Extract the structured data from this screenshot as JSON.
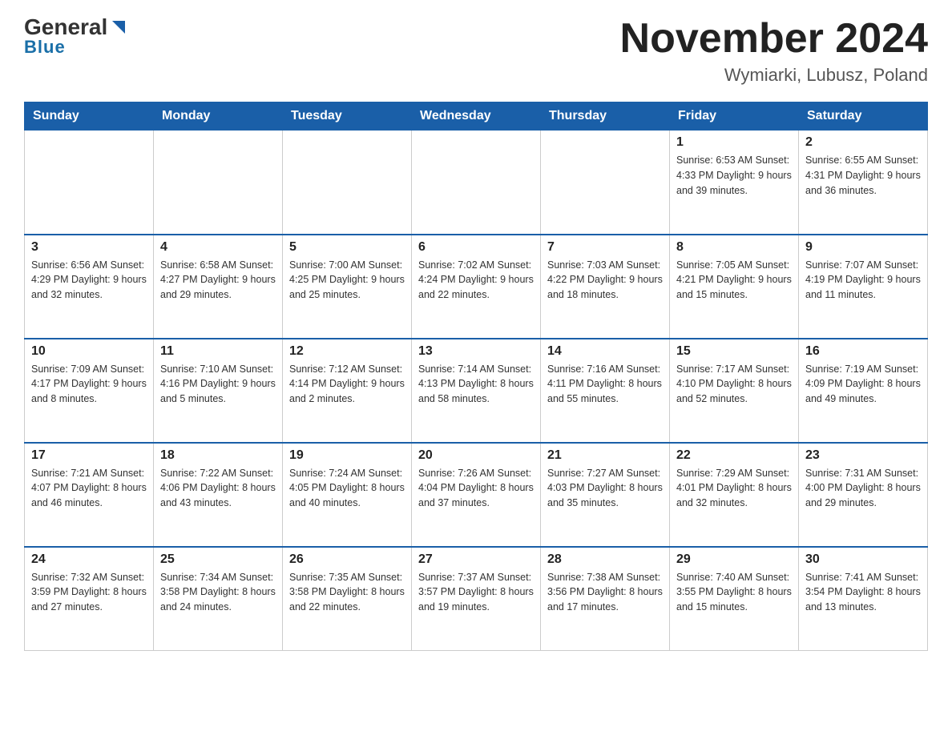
{
  "header": {
    "logo": {
      "general": "General",
      "blue": "Blue"
    },
    "title": "November 2024",
    "subtitle": "Wymiarki, Lubusz, Poland"
  },
  "calendar": {
    "days_of_week": [
      "Sunday",
      "Monday",
      "Tuesday",
      "Wednesday",
      "Thursday",
      "Friday",
      "Saturday"
    ],
    "weeks": [
      [
        {
          "day": "",
          "info": ""
        },
        {
          "day": "",
          "info": ""
        },
        {
          "day": "",
          "info": ""
        },
        {
          "day": "",
          "info": ""
        },
        {
          "day": "",
          "info": ""
        },
        {
          "day": "1",
          "info": "Sunrise: 6:53 AM\nSunset: 4:33 PM\nDaylight: 9 hours\nand 39 minutes."
        },
        {
          "day": "2",
          "info": "Sunrise: 6:55 AM\nSunset: 4:31 PM\nDaylight: 9 hours\nand 36 minutes."
        }
      ],
      [
        {
          "day": "3",
          "info": "Sunrise: 6:56 AM\nSunset: 4:29 PM\nDaylight: 9 hours\nand 32 minutes."
        },
        {
          "day": "4",
          "info": "Sunrise: 6:58 AM\nSunset: 4:27 PM\nDaylight: 9 hours\nand 29 minutes."
        },
        {
          "day": "5",
          "info": "Sunrise: 7:00 AM\nSunset: 4:25 PM\nDaylight: 9 hours\nand 25 minutes."
        },
        {
          "day": "6",
          "info": "Sunrise: 7:02 AM\nSunset: 4:24 PM\nDaylight: 9 hours\nand 22 minutes."
        },
        {
          "day": "7",
          "info": "Sunrise: 7:03 AM\nSunset: 4:22 PM\nDaylight: 9 hours\nand 18 minutes."
        },
        {
          "day": "8",
          "info": "Sunrise: 7:05 AM\nSunset: 4:21 PM\nDaylight: 9 hours\nand 15 minutes."
        },
        {
          "day": "9",
          "info": "Sunrise: 7:07 AM\nSunset: 4:19 PM\nDaylight: 9 hours\nand 11 minutes."
        }
      ],
      [
        {
          "day": "10",
          "info": "Sunrise: 7:09 AM\nSunset: 4:17 PM\nDaylight: 9 hours\nand 8 minutes."
        },
        {
          "day": "11",
          "info": "Sunrise: 7:10 AM\nSunset: 4:16 PM\nDaylight: 9 hours\nand 5 minutes."
        },
        {
          "day": "12",
          "info": "Sunrise: 7:12 AM\nSunset: 4:14 PM\nDaylight: 9 hours\nand 2 minutes."
        },
        {
          "day": "13",
          "info": "Sunrise: 7:14 AM\nSunset: 4:13 PM\nDaylight: 8 hours\nand 58 minutes."
        },
        {
          "day": "14",
          "info": "Sunrise: 7:16 AM\nSunset: 4:11 PM\nDaylight: 8 hours\nand 55 minutes."
        },
        {
          "day": "15",
          "info": "Sunrise: 7:17 AM\nSunset: 4:10 PM\nDaylight: 8 hours\nand 52 minutes."
        },
        {
          "day": "16",
          "info": "Sunrise: 7:19 AM\nSunset: 4:09 PM\nDaylight: 8 hours\nand 49 minutes."
        }
      ],
      [
        {
          "day": "17",
          "info": "Sunrise: 7:21 AM\nSunset: 4:07 PM\nDaylight: 8 hours\nand 46 minutes."
        },
        {
          "day": "18",
          "info": "Sunrise: 7:22 AM\nSunset: 4:06 PM\nDaylight: 8 hours\nand 43 minutes."
        },
        {
          "day": "19",
          "info": "Sunrise: 7:24 AM\nSunset: 4:05 PM\nDaylight: 8 hours\nand 40 minutes."
        },
        {
          "day": "20",
          "info": "Sunrise: 7:26 AM\nSunset: 4:04 PM\nDaylight: 8 hours\nand 37 minutes."
        },
        {
          "day": "21",
          "info": "Sunrise: 7:27 AM\nSunset: 4:03 PM\nDaylight: 8 hours\nand 35 minutes."
        },
        {
          "day": "22",
          "info": "Sunrise: 7:29 AM\nSunset: 4:01 PM\nDaylight: 8 hours\nand 32 minutes."
        },
        {
          "day": "23",
          "info": "Sunrise: 7:31 AM\nSunset: 4:00 PM\nDaylight: 8 hours\nand 29 minutes."
        }
      ],
      [
        {
          "day": "24",
          "info": "Sunrise: 7:32 AM\nSunset: 3:59 PM\nDaylight: 8 hours\nand 27 minutes."
        },
        {
          "day": "25",
          "info": "Sunrise: 7:34 AM\nSunset: 3:58 PM\nDaylight: 8 hours\nand 24 minutes."
        },
        {
          "day": "26",
          "info": "Sunrise: 7:35 AM\nSunset: 3:58 PM\nDaylight: 8 hours\nand 22 minutes."
        },
        {
          "day": "27",
          "info": "Sunrise: 7:37 AM\nSunset: 3:57 PM\nDaylight: 8 hours\nand 19 minutes."
        },
        {
          "day": "28",
          "info": "Sunrise: 7:38 AM\nSunset: 3:56 PM\nDaylight: 8 hours\nand 17 minutes."
        },
        {
          "day": "29",
          "info": "Sunrise: 7:40 AM\nSunset: 3:55 PM\nDaylight: 8 hours\nand 15 minutes."
        },
        {
          "day": "30",
          "info": "Sunrise: 7:41 AM\nSunset: 3:54 PM\nDaylight: 8 hours\nand 13 minutes."
        }
      ]
    ]
  }
}
